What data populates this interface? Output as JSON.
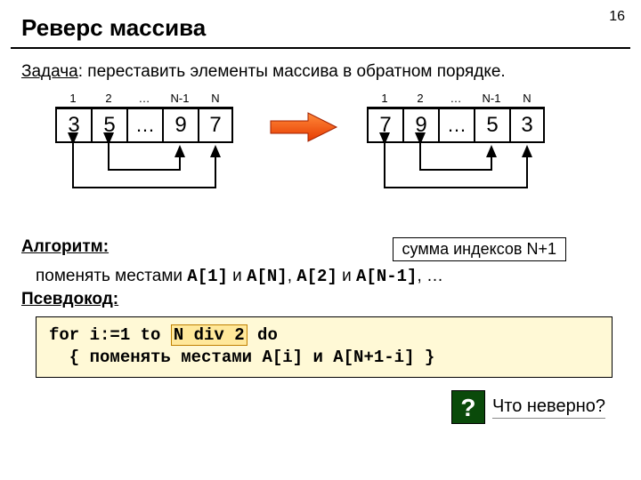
{
  "page_number": "16",
  "title": "Реверс массива",
  "task": {
    "label": "Задача",
    "text": ": переставить элементы массива в обратном порядке."
  },
  "arrays": {
    "left": {
      "idx": [
        "1",
        "2",
        "…",
        "N-1",
        "N"
      ],
      "val": [
        "3",
        "5",
        "…",
        "9",
        "7"
      ]
    },
    "right": {
      "idx": [
        "1",
        "2",
        "…",
        "N-1",
        "N"
      ],
      "val": [
        "7",
        "9",
        "…",
        "5",
        "3"
      ]
    }
  },
  "sum_caption": "сумма индексов N+1",
  "algo_label": "Алгоритм:",
  "algo_text_pre": "поменять местами ",
  "algo_a1": "A[1]",
  "algo_and1": " и ",
  "algo_an": "A[N]",
  "algo_sep": ", ",
  "algo_a2": "A[2]",
  "algo_and2": " и ",
  "algo_an1": "A[N-1]",
  "algo_tail": ", …",
  "pseudo_label": "Псевдокод:",
  "code": {
    "l1a": "for i:=1 to ",
    "l1b": "N div 2",
    "l1c": " do",
    "l2": "  { поменять местами A[i] и A[N+1-i] }"
  },
  "question": {
    "mark": "?",
    "text": "Что неверно?"
  }
}
